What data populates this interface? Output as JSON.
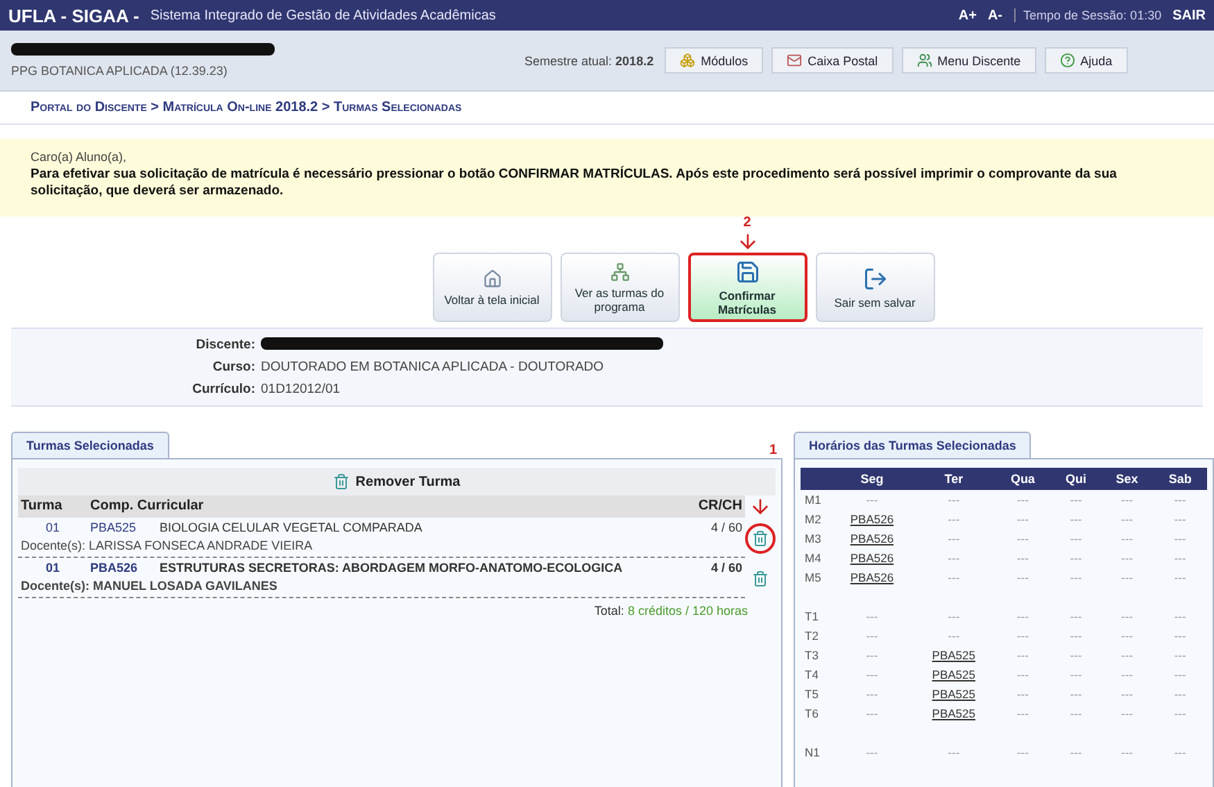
{
  "topbar": {
    "system": "UFLA - SIGAA -",
    "subtitle": "Sistema Integrado de Gestão de Atividades Acadêmicas",
    "font_up": "A+",
    "font_down": "A-",
    "session": "Tempo de Sessão: 01:30",
    "logout": "SAIR"
  },
  "userbar": {
    "unit": "PPG BOTANICA APLICADA (12.39.23)",
    "semester_label": "Semestre atual:",
    "semester": "2018.2",
    "links": [
      {
        "label": "Módulos",
        "kind": "modules"
      },
      {
        "label": "Caixa Postal",
        "kind": "mail"
      },
      {
        "label": "Menu Discente",
        "kind": "menu"
      },
      {
        "label": "Ajuda",
        "kind": "help"
      }
    ]
  },
  "breadcrumb": "Portal do Discente > Matrícula On-line 2018.2 > Turmas Selecionadas",
  "notice": {
    "greeting": "Caro(a) Aluno(a),",
    "message": "Para efetivar sua solicitação de matrícula é necessário pressionar o botão CONFIRMAR MATRÍCULAS. Após este procedimento será possível imprimir o comprovante da sua solicitação, que deverá ser armazenado."
  },
  "actions": [
    {
      "label": "Voltar à tela inicial",
      "kind": "home",
      "highlighted": false
    },
    {
      "label": "Ver as turmas do programa",
      "kind": "tree",
      "highlighted": false
    },
    {
      "label": "Confirmar Matrículas",
      "kind": "confirm",
      "highlighted": true,
      "annotation": "2"
    },
    {
      "label": "Sair sem salvar",
      "kind": "exit",
      "highlighted": false
    }
  ],
  "student": [
    {
      "label": "Discente:",
      "redacted": true
    },
    {
      "label": "Curso:",
      "value": "DOUTORADO EM BOTANICA APLICADA - DOUTORADO",
      "redacted": false
    },
    {
      "label": "Currículo:",
      "value": "01D12012/01",
      "redacted": false
    }
  ],
  "selected_panel": {
    "tab": "Turmas Selecionadas",
    "remove_label": "Remover Turma",
    "annotation": "1",
    "columns": [
      "Turma",
      "Comp. Curricular",
      "CR/CH"
    ],
    "rows": [
      {
        "turma": "01",
        "code": "PBA525",
        "name": "BIOLOGIA CELULAR VEGETAL COMPARADA",
        "crch": "4 / 60",
        "teacher_label": "Docente(s):",
        "teacher": "LARISSA FONSECA ANDRADE VIEIRA",
        "circled": true
      },
      {
        "turma": "01",
        "code": "PBA526",
        "name": "ESTRUTURAS SECRETORAS: ABORDAGEM MORFO-ANATOMO-ECOLOGICA",
        "crch": "4 / 60",
        "teacher_label": "Docente(s):",
        "teacher": "MANUEL LOSADA GAVILANES",
        "circled": false
      }
    ],
    "total_label": "Total:",
    "total": "8 créditos / 120 horas"
  },
  "schedule_panel": {
    "tab": "Horários das Turmas Selecionadas",
    "days": [
      "Seg",
      "Ter",
      "Qua",
      "Qui",
      "Sex",
      "Sab"
    ],
    "rows": [
      {
        "kind": "slot",
        "label": "M1",
        "cells": [
          {
            "kind": "empty",
            "text": "---"
          },
          {
            "kind": "empty",
            "text": "---"
          },
          {
            "kind": "empty",
            "text": "---"
          },
          {
            "kind": "empty",
            "text": "---"
          },
          {
            "kind": "empty",
            "text": "---"
          },
          {
            "kind": "empty",
            "text": "---"
          }
        ]
      },
      {
        "kind": "slot",
        "label": "M2",
        "cells": [
          {
            "kind": "class",
            "text": "PBA526"
          },
          {
            "kind": "empty",
            "text": "---"
          },
          {
            "kind": "empty",
            "text": "---"
          },
          {
            "kind": "empty",
            "text": "---"
          },
          {
            "kind": "empty",
            "text": "---"
          },
          {
            "kind": "empty",
            "text": "---"
          }
        ]
      },
      {
        "kind": "slot",
        "label": "M3",
        "cells": [
          {
            "kind": "class",
            "text": "PBA526"
          },
          {
            "kind": "empty",
            "text": "---"
          },
          {
            "kind": "empty",
            "text": "---"
          },
          {
            "kind": "empty",
            "text": "---"
          },
          {
            "kind": "empty",
            "text": "---"
          },
          {
            "kind": "empty",
            "text": "---"
          }
        ]
      },
      {
        "kind": "slot",
        "label": "M4",
        "cells": [
          {
            "kind": "class",
            "text": "PBA526"
          },
          {
            "kind": "empty",
            "text": "---"
          },
          {
            "kind": "empty",
            "text": "---"
          },
          {
            "kind": "empty",
            "text": "---"
          },
          {
            "kind": "empty",
            "text": "---"
          },
          {
            "kind": "empty",
            "text": "---"
          }
        ]
      },
      {
        "kind": "slot",
        "label": "M5",
        "cells": [
          {
            "kind": "class",
            "text": "PBA526"
          },
          {
            "kind": "empty",
            "text": "---"
          },
          {
            "kind": "empty",
            "text": "---"
          },
          {
            "kind": "empty",
            "text": "---"
          },
          {
            "kind": "empty",
            "text": "---"
          },
          {
            "kind": "empty",
            "text": "---"
          }
        ]
      },
      {
        "kind": "gap"
      },
      {
        "kind": "slot",
        "label": "T1",
        "cells": [
          {
            "kind": "empty",
            "text": "---"
          },
          {
            "kind": "empty",
            "text": "---"
          },
          {
            "kind": "empty",
            "text": "---"
          },
          {
            "kind": "empty",
            "text": "---"
          },
          {
            "kind": "empty",
            "text": "---"
          },
          {
            "kind": "empty",
            "text": "---"
          }
        ]
      },
      {
        "kind": "slot",
        "label": "T2",
        "cells": [
          {
            "kind": "empty",
            "text": "---"
          },
          {
            "kind": "empty",
            "text": "---"
          },
          {
            "kind": "empty",
            "text": "---"
          },
          {
            "kind": "empty",
            "text": "---"
          },
          {
            "kind": "empty",
            "text": "---"
          },
          {
            "kind": "empty",
            "text": "---"
          }
        ]
      },
      {
        "kind": "slot",
        "label": "T3",
        "cells": [
          {
            "kind": "empty",
            "text": "---"
          },
          {
            "kind": "class",
            "text": "PBA525"
          },
          {
            "kind": "empty",
            "text": "---"
          },
          {
            "kind": "empty",
            "text": "---"
          },
          {
            "kind": "empty",
            "text": "---"
          },
          {
            "kind": "empty",
            "text": "---"
          }
        ]
      },
      {
        "kind": "slot",
        "label": "T4",
        "cells": [
          {
            "kind": "empty",
            "text": "---"
          },
          {
            "kind": "class",
            "text": "PBA525"
          },
          {
            "kind": "empty",
            "text": "---"
          },
          {
            "kind": "empty",
            "text": "---"
          },
          {
            "kind": "empty",
            "text": "---"
          },
          {
            "kind": "empty",
            "text": "---"
          }
        ]
      },
      {
        "kind": "slot",
        "label": "T5",
        "cells": [
          {
            "kind": "empty",
            "text": "---"
          },
          {
            "kind": "class",
            "text": "PBA525"
          },
          {
            "kind": "empty",
            "text": "---"
          },
          {
            "kind": "empty",
            "text": "---"
          },
          {
            "kind": "empty",
            "text": "---"
          },
          {
            "kind": "empty",
            "text": "---"
          }
        ]
      },
      {
        "kind": "slot",
        "label": "T6",
        "cells": [
          {
            "kind": "empty",
            "text": "---"
          },
          {
            "kind": "class",
            "text": "PBA525"
          },
          {
            "kind": "empty",
            "text": "---"
          },
          {
            "kind": "empty",
            "text": "---"
          },
          {
            "kind": "empty",
            "text": "---"
          },
          {
            "kind": "empty",
            "text": "---"
          }
        ]
      },
      {
        "kind": "gap"
      },
      {
        "kind": "slot",
        "label": "N1",
        "cells": [
          {
            "kind": "empty",
            "text": "---"
          },
          {
            "kind": "empty",
            "text": "---"
          },
          {
            "kind": "empty",
            "text": "---"
          },
          {
            "kind": "empty",
            "text": "---"
          },
          {
            "kind": "empty",
            "text": "---"
          },
          {
            "kind": "empty",
            "text": "---"
          }
        ]
      }
    ]
  }
}
